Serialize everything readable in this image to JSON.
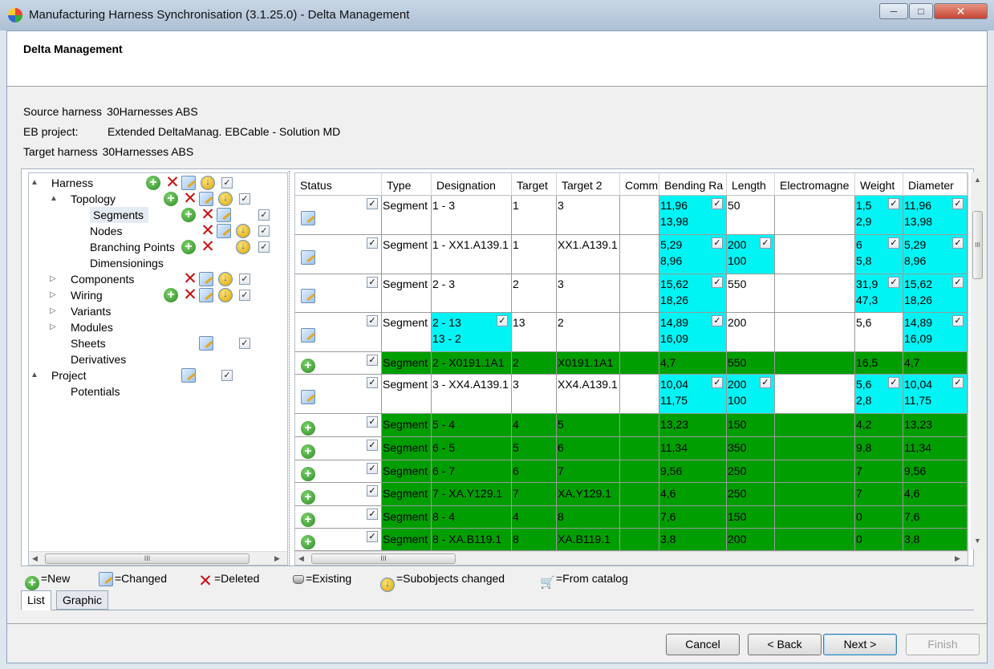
{
  "window": {
    "title": "Manufacturing Harness Synchronisation (3.1.25.0) - Delta Management",
    "buttons": {
      "minimize": "─",
      "maximize": "□",
      "close": "✕"
    }
  },
  "banner": {
    "title": "Delta Management"
  },
  "info": {
    "source_label": "Source harness",
    "source_value": "30Harnesses ABS",
    "eb_label": "EB project:",
    "eb_value": "Extended DeltaManag. EBCable - Solution MD",
    "target_label": "Target harness",
    "target_value": "30Harnesses ABS"
  },
  "tree": {
    "items": [
      {
        "label": "Harness",
        "level": 0,
        "expander": "▲"
      },
      {
        "label": "Topology",
        "level": 1,
        "expander": "▲"
      },
      {
        "label": "Segments",
        "level": 2,
        "selected": true
      },
      {
        "label": "Nodes",
        "level": 2
      },
      {
        "label": "Branching Points",
        "level": 2
      },
      {
        "label": "Dimensionings",
        "level": 2
      },
      {
        "label": "Components",
        "level": 1,
        "expander": "▷"
      },
      {
        "label": "Wiring",
        "level": 1,
        "expander": "▷"
      },
      {
        "label": "Variants",
        "level": 1,
        "expander": "▷"
      },
      {
        "label": "Modules",
        "level": 1,
        "expander": "▷"
      },
      {
        "label": "Sheets",
        "level": 1
      },
      {
        "label": "Derivatives",
        "level": 1
      },
      {
        "label": "Project",
        "level": 0,
        "expander": "▲"
      },
      {
        "label": "Potentials",
        "level": 1
      }
    ]
  },
  "grid": {
    "columns": [
      "Status",
      "Type",
      "Designation",
      "Target",
      "Target 2",
      "Comm",
      "Bending Ra",
      "Length",
      "Electromagne",
      "Weight",
      "Diameter"
    ],
    "rows": [
      {
        "status": "changed",
        "type": "Segment",
        "designation": "1 - 3",
        "target": "1",
        "target2": "3",
        "bending": "11,96\n13,98",
        "length": "50",
        "weight": "1,5\n2,9",
        "diameter": "11,96\n13,98"
      },
      {
        "status": "changed",
        "type": "Segment",
        "designation": "1 - XX1.A139.1",
        "target": "1",
        "target2": "XX1.A139.1",
        "bending": "5,29\n8,96",
        "length": "200\n100",
        "weight": "6\n5,8",
        "diameter": "5,29\n8,96"
      },
      {
        "status": "changed",
        "type": "Segment",
        "designation": "2 - 3",
        "target": "2",
        "target2": "3",
        "bending": "15,62\n18,26",
        "length": "550",
        "weight": "31,9\n47,3",
        "diameter": "15,62\n18,26"
      },
      {
        "status": "changed",
        "type": "Segment",
        "designation": "2 - 13\n13 - 2",
        "target": "13",
        "target2": "2",
        "bending": "14,89\n16,09",
        "length": "200",
        "weight": "5,6",
        "diameter": "14,89\n16,09"
      },
      {
        "status": "new",
        "type": "Segment",
        "designation": "2 - X0191.1A1",
        "target": "2",
        "target2": "X0191.1A1",
        "bending": "4,7",
        "length": "550",
        "weight": "16,5",
        "diameter": "4,7"
      },
      {
        "status": "changed",
        "type": "Segment",
        "designation": "3 - XX4.A139.1",
        "target": "3",
        "target2": "XX4.A139.1",
        "bending": "10,04\n11,75",
        "length": "200\n100",
        "weight": "5,6\n2,8",
        "diameter": "10,04\n11,75"
      },
      {
        "status": "new",
        "type": "Segment",
        "designation": "5 - 4",
        "target": "4",
        "target2": "5",
        "bending": "13,23",
        "length": "150",
        "weight": "4,2",
        "diameter": "13,23"
      },
      {
        "status": "new",
        "type": "Segment",
        "designation": "6 - 5",
        "target": "5",
        "target2": "6",
        "bending": "11,34",
        "length": "350",
        "weight": "9,8",
        "diameter": "11,34"
      },
      {
        "status": "new",
        "type": "Segment",
        "designation": "6 - 7",
        "target": "6",
        "target2": "7",
        "bending": "9,56",
        "length": "250",
        "weight": "7",
        "diameter": "9,56"
      },
      {
        "status": "new",
        "type": "Segment",
        "designation": "7 - XA.Y129.1",
        "target": "7",
        "target2": "XA.Y129.1",
        "bending": "4,6",
        "length": "250",
        "weight": "7",
        "diameter": "4,6"
      },
      {
        "status": "new",
        "type": "Segment",
        "designation": "8 - 4",
        "target": "4",
        "target2": "8",
        "bending": "7,6",
        "length": "150",
        "weight": "0",
        "diameter": "7,6"
      },
      {
        "status": "new",
        "type": "Segment",
        "designation": "8 - XA.B119.1",
        "target": "8",
        "target2": "XA.B119.1",
        "bending": "3,8",
        "length": "200",
        "weight": "0",
        "diameter": "3,8"
      }
    ]
  },
  "legend": {
    "new": "=New",
    "changed": "=Changed",
    "deleted": "=Deleted",
    "existing": "=Existing",
    "subobjects": "=Subobjects changed",
    "catalog": "=From catalog"
  },
  "tabs": {
    "list": "List",
    "graphic": "Graphic"
  },
  "footer": {
    "cancel": "Cancel",
    "back": "< Back",
    "next": "Next >",
    "finish": "Finish"
  },
  "glyphs": {
    "check": "✓",
    "plus": "+",
    "cross": "✕",
    "sub": "↓",
    "scroll_grip": "III"
  },
  "colors": {
    "new_row": "#009e00",
    "changed_cell": "#00f4f4"
  }
}
